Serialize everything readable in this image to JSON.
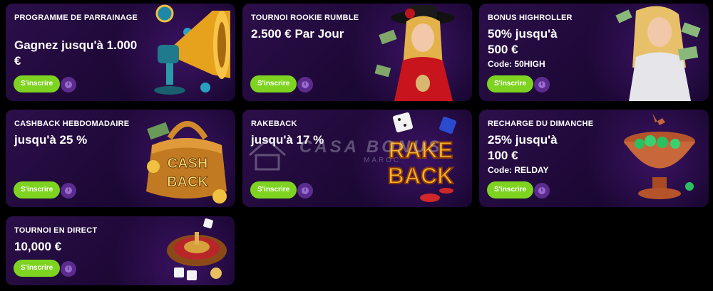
{
  "cards": [
    {
      "label": "PROGRAMME DE PARRAINAGE",
      "headline": "Gagnez jusqu'à 1.000 €",
      "code": "",
      "button": "S'inscrire",
      "art": "megaphone-icon"
    },
    {
      "label": "TOURNOI ROOKIE RUMBLE",
      "headline": "2.500 € Par Jour",
      "code": "",
      "button": "S'inscrire",
      "art": "cowgirl-illustration"
    },
    {
      "label": "BONUS HIGHROLLER",
      "headline": "50% jusqu'à 500 €",
      "code": "Code: 50HIGH",
      "button": "S'inscrire",
      "art": "woman-with-money-illustration"
    },
    {
      "label": "CASHBACK HEBDOMADAIRE",
      "headline": "jusqu'à 25 %",
      "code": "",
      "button": "S'inscrire",
      "art": "cashback-bag-illustration",
      "art_text": "CASH BACK"
    },
    {
      "label": "RAKEBACK",
      "headline": "jusqu'à 17 %",
      "code": "",
      "button": "S'inscrire",
      "art": "rakeback-text-illustration",
      "art_text": "RAKE BACK"
    },
    {
      "label": "RECHARGE DU DIMANCHE",
      "headline": "25% jusqu'à 100 €",
      "code": "Code: RELDAY",
      "button": "S'inscrire",
      "art": "gem-bowl-illustration"
    },
    {
      "label": "TOURNOI EN DIRECT",
      "headline": "10,000 €",
      "code": "",
      "button": "S'inscrire",
      "art": "roulette-icon"
    }
  ],
  "watermark": {
    "text": "CASA BONUS",
    "sub": "MAROC"
  },
  "colors": {
    "button": "#7ed321",
    "card_bg": "#1d0836",
    "info": "#5b2c8e"
  }
}
